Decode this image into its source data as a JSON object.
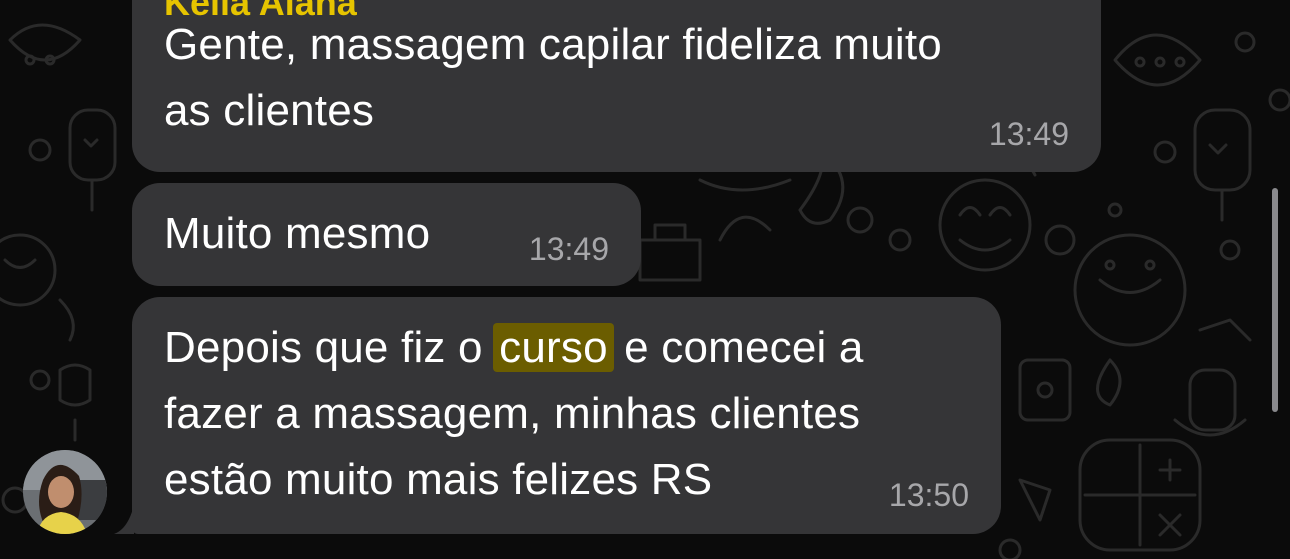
{
  "messages": [
    {
      "sender": "Kelia Alana",
      "lines": [
        "Gente, massagem capilar fideliza muito",
        "as clientes"
      ],
      "time": "13:49"
    },
    {
      "lines": [
        "Muito mesmo"
      ],
      "time": "13:49"
    },
    {
      "line1_before": "Depois que fiz o ",
      "line1_highlight": "curso",
      "line1_after": " e comecei a",
      "line2": "a fazer a massagem, minhas clientes",
      "line2_display": "fazer a massagem, minhas clientes",
      "line3": "estão muito mais felizes RS",
      "time": "13:50"
    }
  ],
  "colors": {
    "background": "#0b0b0b",
    "bubble": "#353537",
    "sender_name": "#e6c400",
    "highlight": "#6b5d00",
    "timestamp": "#a7a7aa"
  },
  "icons": {
    "avatar": "sender-avatar-photo",
    "scrollbar": "vertical-scrollbar"
  }
}
